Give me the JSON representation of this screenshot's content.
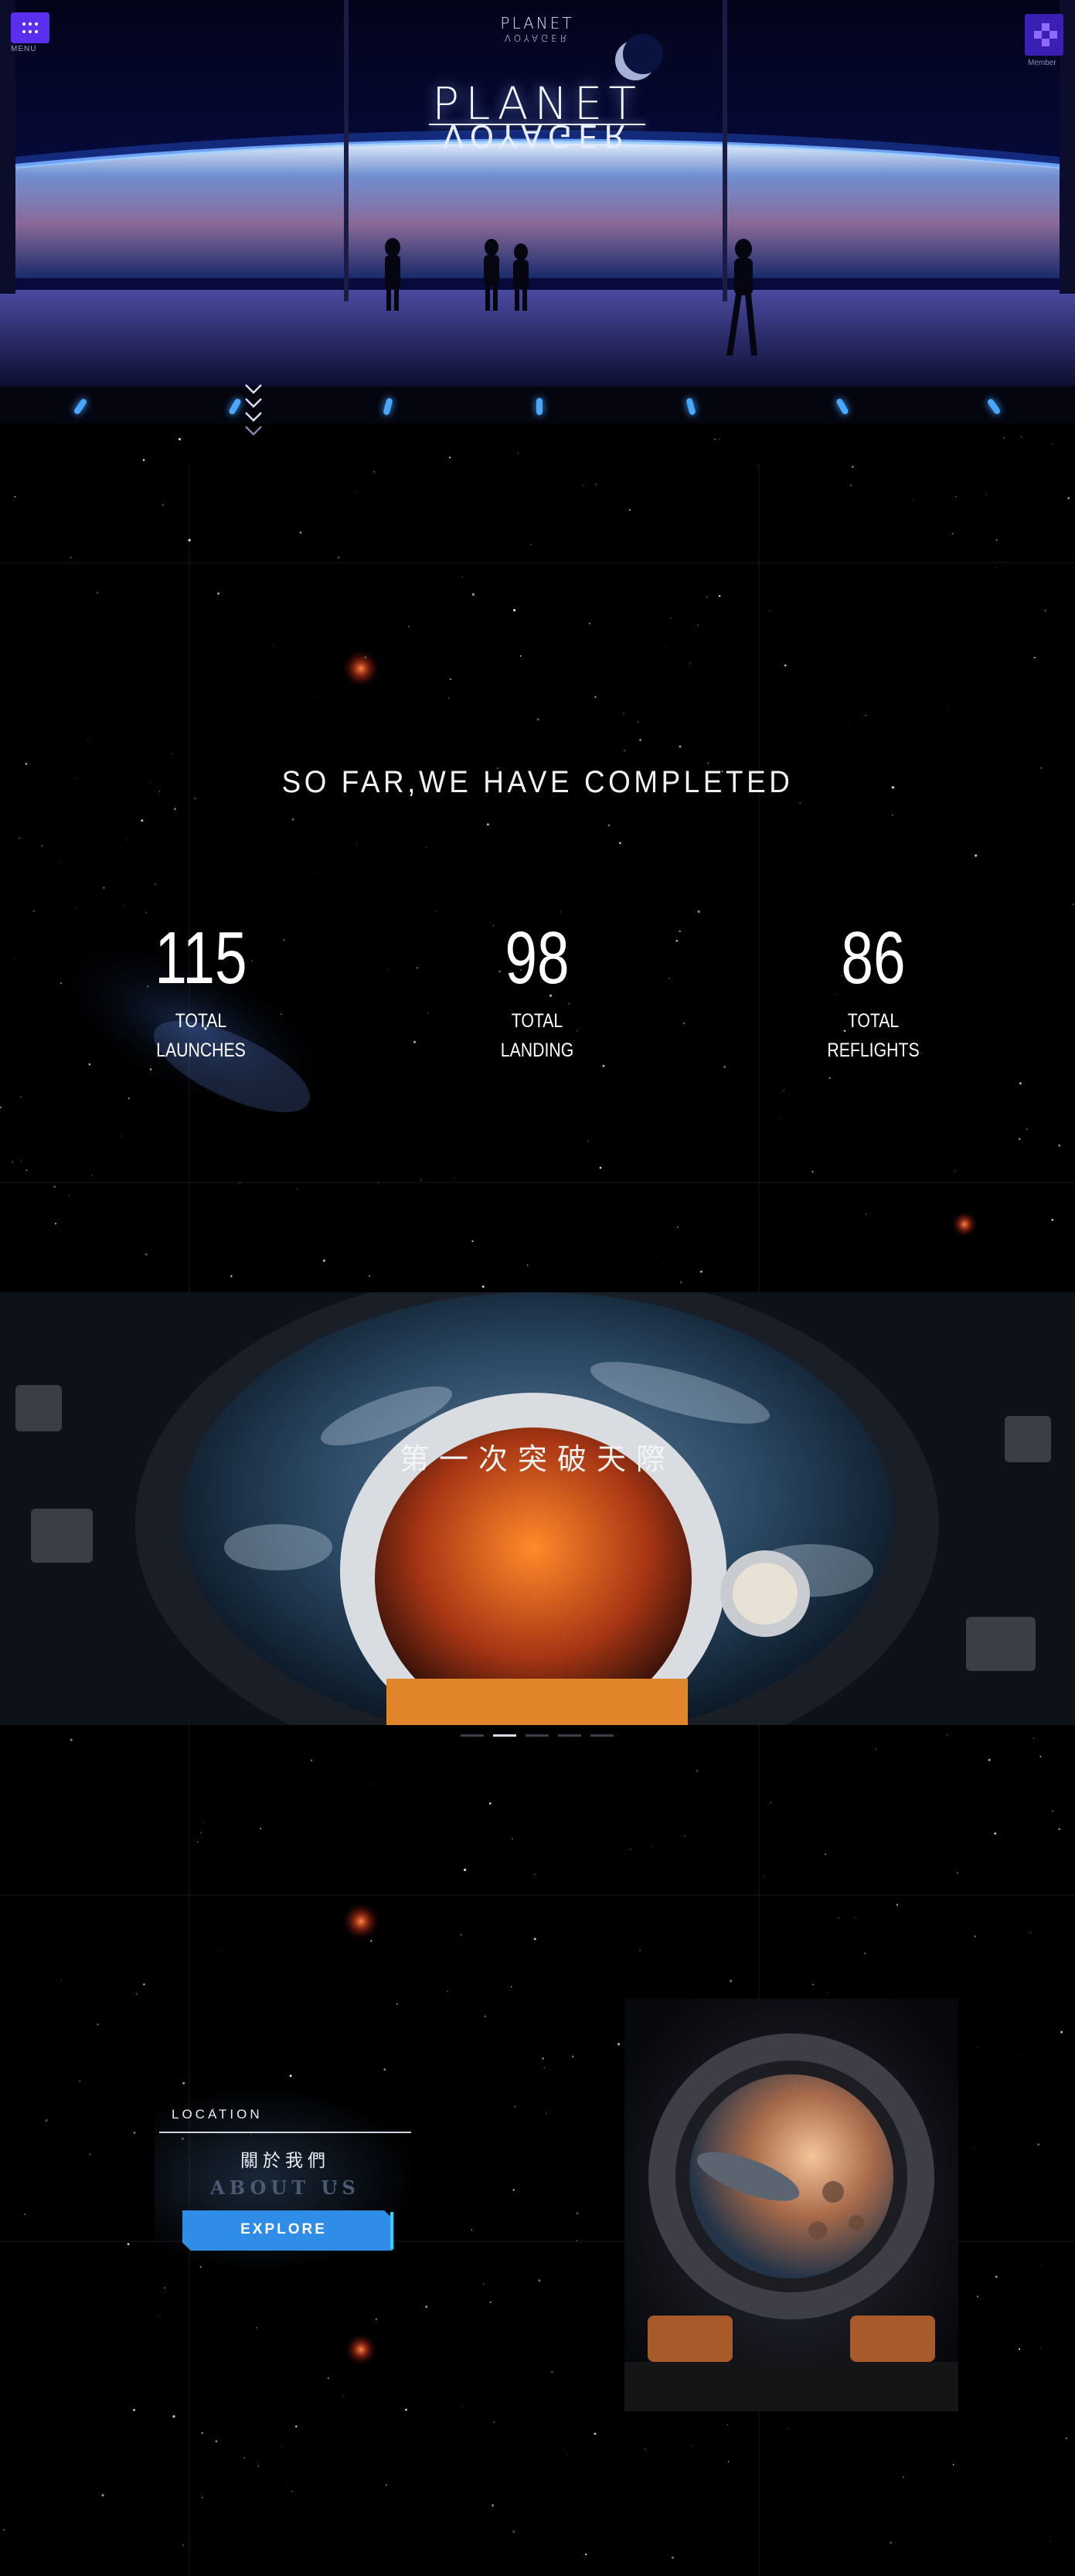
{
  "header": {
    "menu_label": "MENU",
    "member_label": "Member",
    "logo_top": "PLANET",
    "logo_top_sub": "VOYAGER",
    "logo_main": "PLANET",
    "logo_main_sub": "VOYAGER"
  },
  "stats": {
    "title": "SO FAR,WE HAVE COMPLETED",
    "items": [
      {
        "number": "115",
        "label_line1": "TOTAL",
        "label_line2": "LAUNCHES"
      },
      {
        "number": "98",
        "label_line1": "TOTAL",
        "label_line2": "LANDING"
      },
      {
        "number": "86",
        "label_line1": "TOTAL",
        "label_line2": "REFLIGHTS"
      }
    ]
  },
  "banner": {
    "title": "第一次突破天際",
    "slides_total": 5,
    "active_slide": 2
  },
  "about": {
    "location_label": "LOCATION",
    "title_cn": "關於我們",
    "title_en": "ABOUT US",
    "button_label": "EXPLORE"
  },
  "colors": {
    "accent_purple": "#5b2ff0",
    "accent_blue": "#2f8de8",
    "hero_glow": "#4aa7ff",
    "background": "#000000"
  },
  "icons": {
    "menu": "grid-dots-icon",
    "member": "pixel-block-icon",
    "scroll": "chevron-down-icon"
  }
}
